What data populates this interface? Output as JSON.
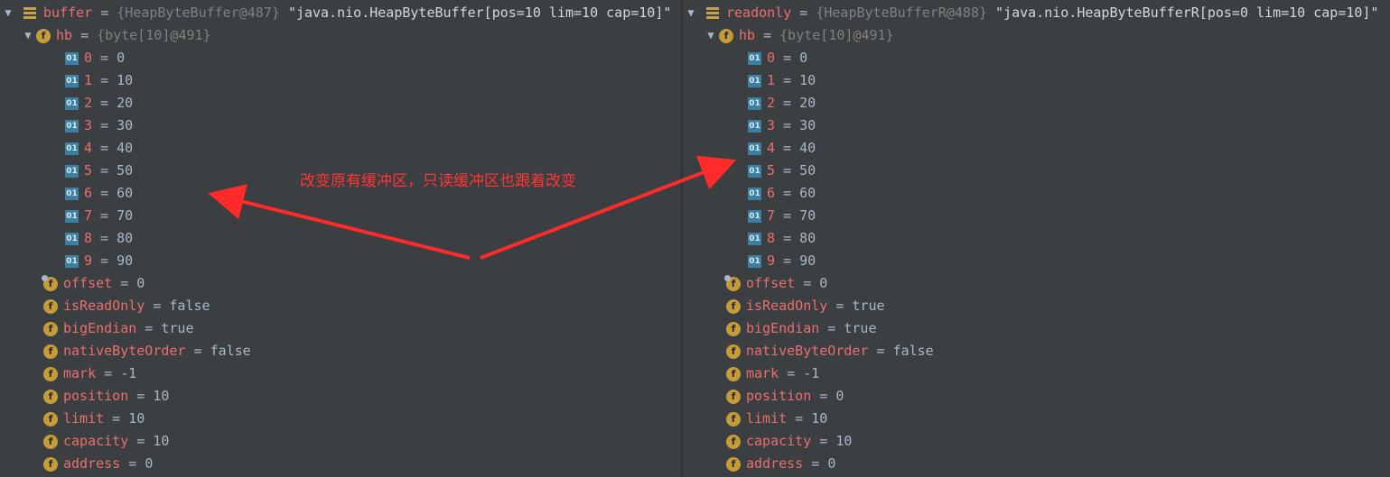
{
  "left": {
    "root": {
      "name": "buffer",
      "ref": "{HeapByteBuffer@487}",
      "str": "\"java.nio.HeapByteBuffer[pos=10 lim=10 cap=10]\""
    },
    "hb": {
      "name": "hb",
      "ref": "{byte[10]@491}"
    },
    "elements": [
      {
        "i": "0",
        "v": "0"
      },
      {
        "i": "1",
        "v": "10"
      },
      {
        "i": "2",
        "v": "20"
      },
      {
        "i": "3",
        "v": "30"
      },
      {
        "i": "4",
        "v": "40"
      },
      {
        "i": "5",
        "v": "50"
      },
      {
        "i": "6",
        "v": "60"
      },
      {
        "i": "7",
        "v": "70"
      },
      {
        "i": "8",
        "v": "80"
      },
      {
        "i": "9",
        "v": "90"
      }
    ],
    "fields": [
      {
        "name": "offset",
        "value": "0"
      },
      {
        "name": "isReadOnly",
        "value": "false"
      },
      {
        "name": "bigEndian",
        "value": "true"
      },
      {
        "name": "nativeByteOrder",
        "value": "false"
      },
      {
        "name": "mark",
        "value": "-1"
      },
      {
        "name": "position",
        "value": "10"
      },
      {
        "name": "limit",
        "value": "10"
      },
      {
        "name": "capacity",
        "value": "10"
      },
      {
        "name": "address",
        "value": "0"
      }
    ]
  },
  "right": {
    "root": {
      "name": "readonly",
      "ref": "{HeapByteBufferR@488}",
      "str": "\"java.nio.HeapByteBufferR[pos=0 lim=10 cap=10]\""
    },
    "hb": {
      "name": "hb",
      "ref": "{byte[10]@491}"
    },
    "elements": [
      {
        "i": "0",
        "v": "0"
      },
      {
        "i": "1",
        "v": "10"
      },
      {
        "i": "2",
        "v": "20"
      },
      {
        "i": "3",
        "v": "30"
      },
      {
        "i": "4",
        "v": "40"
      },
      {
        "i": "5",
        "v": "50"
      },
      {
        "i": "6",
        "v": "60"
      },
      {
        "i": "7",
        "v": "70"
      },
      {
        "i": "8",
        "v": "80"
      },
      {
        "i": "9",
        "v": "90"
      }
    ],
    "fields": [
      {
        "name": "offset",
        "value": "0"
      },
      {
        "name": "isReadOnly",
        "value": "true"
      },
      {
        "name": "bigEndian",
        "value": "true"
      },
      {
        "name": "nativeByteOrder",
        "value": "false"
      },
      {
        "name": "mark",
        "value": "-1"
      },
      {
        "name": "position",
        "value": "0"
      },
      {
        "name": "limit",
        "value": "10"
      },
      {
        "name": "capacity",
        "value": "10"
      },
      {
        "name": "address",
        "value": "0"
      }
    ]
  },
  "icons": {
    "expanded": "expand-triangle-icon",
    "object": "object-icon",
    "field": "field-icon",
    "element": "array-element-icon"
  },
  "colors": {
    "background": "#3c3f41",
    "name": "#ea6e6e",
    "annotation": "#ff3434",
    "field_icon": "#c69c3b"
  },
  "annotation": "改变原有缓冲区，只读缓冲区也跟着改变"
}
